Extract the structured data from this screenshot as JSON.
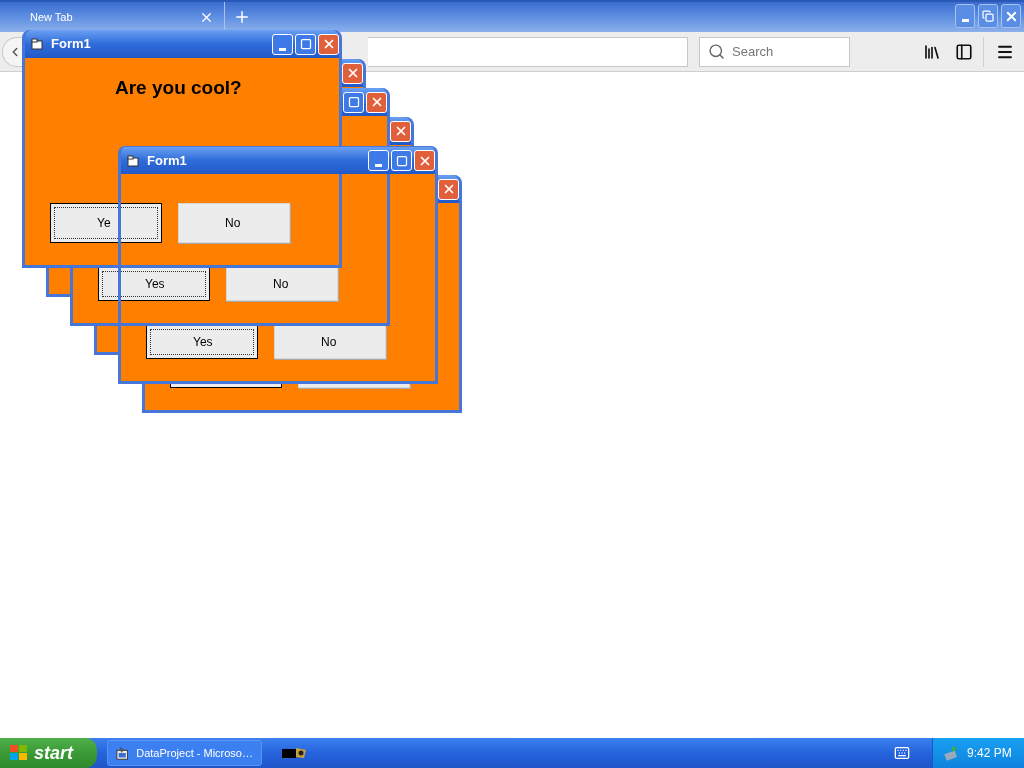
{
  "browser": {
    "tabs": [
      {
        "title": "New Tab"
      }
    ],
    "search": {
      "placeholder": "Search"
    }
  },
  "forms": [
    {
      "kind": "form",
      "title": "Form1",
      "label": "Are you cool?",
      "buttons": [
        {
          "label": "Ye",
          "focused": true
        },
        {
          "label": "No",
          "focused": false
        }
      ]
    },
    {
      "kind": "form"
    },
    {
      "kind": "form",
      "buttons": [
        {
          "label": "Yes",
          "focused": true
        },
        {
          "label": "No",
          "focused": false
        }
      ]
    },
    {
      "kind": "form"
    },
    {
      "kind": "form",
      "title": "Form1",
      "buttons": [
        {
          "label": "Yes",
          "focused": true
        },
        {
          "label": "No",
          "focused": false
        }
      ]
    },
    {
      "kind": "form",
      "buttons": [
        {
          "focused": true
        },
        {
          "focused": false
        }
      ]
    }
  ],
  "taskbar": {
    "start": "start",
    "tasks": [
      {
        "kind": "app",
        "label": "DataProject - Microso…"
      },
      {
        "kind": "icon"
      }
    ],
    "clock": "9:42 PM"
  }
}
